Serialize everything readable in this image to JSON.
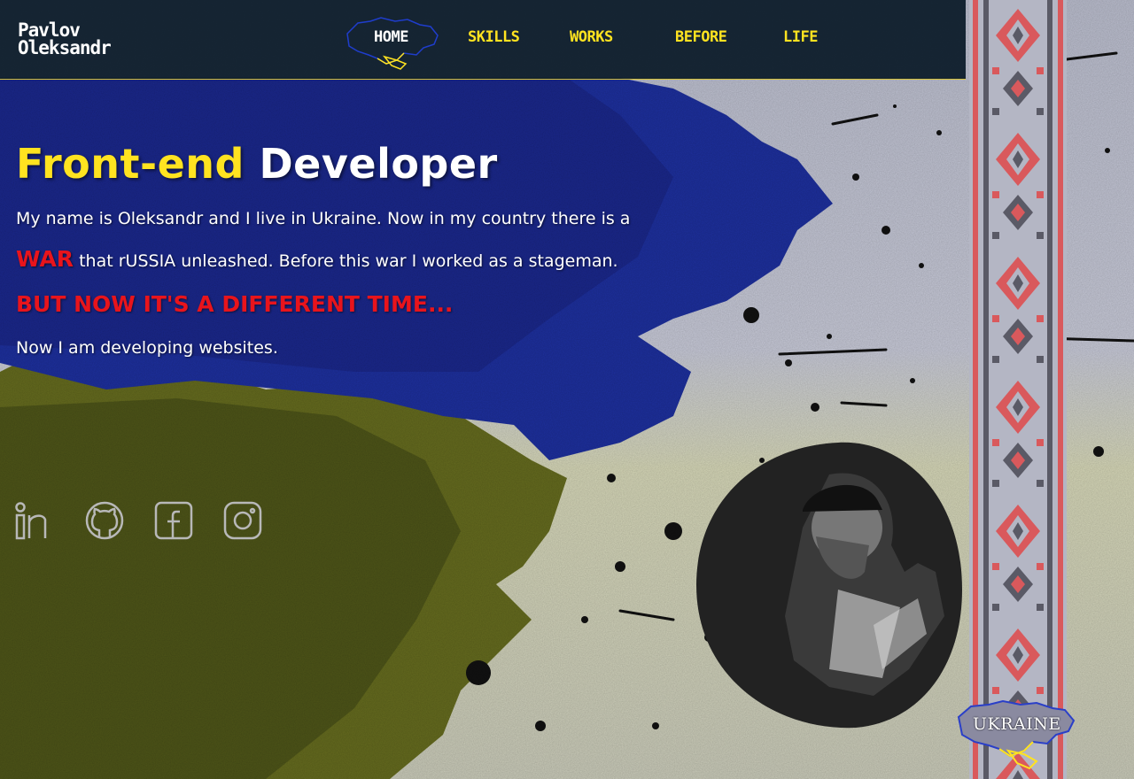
{
  "header": {
    "logo_line1": "Pavlov",
    "logo_line2": "Oleksandr",
    "nav": [
      {
        "label": "HOME",
        "active": true
      },
      {
        "label": "SKILLS",
        "active": false
      },
      {
        "label": "WORKS",
        "active": false
      },
      {
        "label": "BEFORE",
        "active": false
      },
      {
        "label": "LIFE",
        "active": false
      }
    ]
  },
  "hero": {
    "title_highlight": "Front-end",
    "title_rest": "Developer",
    "line1": "My name is Oleksandr and I live in Ukraine. Now in my country there is a",
    "war_word": "WAR",
    "line2_rest": "that rUSSIA unleashed. Before this war I worked as a stageman.",
    "different_time": "BUT NOW IT'S A DIFFERENT TIME...",
    "line3": "Now I am developing websites."
  },
  "social": [
    "linkedin-icon",
    "github-icon",
    "facebook-icon",
    "instagram-icon"
  ],
  "badge": {
    "label": "UKRAINE"
  },
  "colors": {
    "accent_yellow": "#ffe320",
    "flag_blue": "#1b2fa0",
    "flag_yellow": "#8a8f1e",
    "red": "#e8141c",
    "nav_bg": "#0a1a28"
  }
}
